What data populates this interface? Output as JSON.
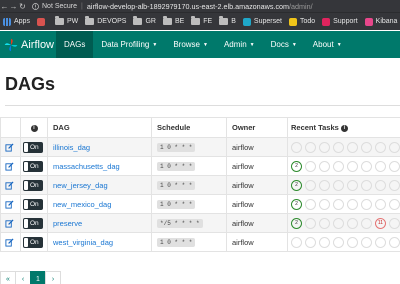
{
  "browser": {
    "security_label": "Not Secure",
    "url_host": "airflow-develop-alb-1892979170.us-east-2.elb.amazonaws.com",
    "url_path": "/admin/"
  },
  "bookmarks": [
    {
      "label": "Apps",
      "kind": "apps"
    },
    {
      "label": "",
      "kind": "app",
      "color": "#d9534f"
    },
    {
      "label": "PW",
      "kind": "folder"
    },
    {
      "label": "DEVOPS",
      "kind": "folder"
    },
    {
      "label": "GR",
      "kind": "folder"
    },
    {
      "label": "BE",
      "kind": "folder"
    },
    {
      "label": "FE",
      "kind": "folder"
    },
    {
      "label": "B",
      "kind": "folder"
    },
    {
      "label": "Superset",
      "kind": "site",
      "color": "#1fa7c9"
    },
    {
      "label": "Todo",
      "kind": "site",
      "color": "#f0c419"
    },
    {
      "label": "Support",
      "kind": "site",
      "color": "#e0245e"
    },
    {
      "label": "Kibana",
      "kind": "site",
      "color": "#e8478b"
    },
    {
      "label": "Admi",
      "kind": "site",
      "color": "#7b61ff"
    }
  ],
  "nav": {
    "brand": "Airflow",
    "items": [
      {
        "label": "DAGs",
        "active": true,
        "dropdown": false
      },
      {
        "label": "Data Profiling",
        "active": false,
        "dropdown": true
      },
      {
        "label": "Browse",
        "active": false,
        "dropdown": true
      },
      {
        "label": "Admin",
        "active": false,
        "dropdown": true
      },
      {
        "label": "Docs",
        "active": false,
        "dropdown": true
      },
      {
        "label": "About",
        "active": false,
        "dropdown": true
      }
    ]
  },
  "page": {
    "title": "DAGs"
  },
  "table": {
    "headers": {
      "info": "i",
      "dag": "DAG",
      "schedule": "Schedule",
      "owner": "Owner",
      "recent_tasks": "Recent Tasks"
    },
    "rows": [
      {
        "toggle": "On",
        "dag": "illinois_dag",
        "schedule": "1 0 * * *",
        "owner": "airflow",
        "tasks": [
          {
            "state": "empty",
            "count": ""
          }
        ]
      },
      {
        "toggle": "On",
        "dag": "massachusetts_dag",
        "schedule": "1 0 * * *",
        "owner": "airflow",
        "tasks": [
          {
            "state": "success",
            "count": "2"
          }
        ]
      },
      {
        "toggle": "On",
        "dag": "new_jersey_dag",
        "schedule": "1 0 * * *",
        "owner": "airflow",
        "tasks": [
          {
            "state": "success",
            "count": "2"
          }
        ]
      },
      {
        "toggle": "On",
        "dag": "new_mexico_dag",
        "schedule": "1 0 * * *",
        "owner": "airflow",
        "tasks": [
          {
            "state": "success",
            "count": "2"
          }
        ]
      },
      {
        "toggle": "On",
        "dag": "preserve",
        "schedule": "*/5 * * * *",
        "owner": "airflow",
        "tasks": [
          {
            "state": "success",
            "count": "2"
          },
          {
            "state": "failed",
            "count": "11",
            "position": 6
          }
        ]
      },
      {
        "toggle": "On",
        "dag": "west_virginia_dag",
        "schedule": "1 0 * * *",
        "owner": "airflow",
        "tasks": [
          {
            "state": "empty",
            "count": ""
          }
        ]
      }
    ]
  },
  "pagination": {
    "first": "«",
    "prev": "‹",
    "current": "1",
    "next": "›"
  },
  "colors": {
    "nav_bg": "#00796b",
    "nav_active": "#005c51",
    "link": "#1976d2",
    "success": "#2e8b2e",
    "failed": "#e57373"
  }
}
